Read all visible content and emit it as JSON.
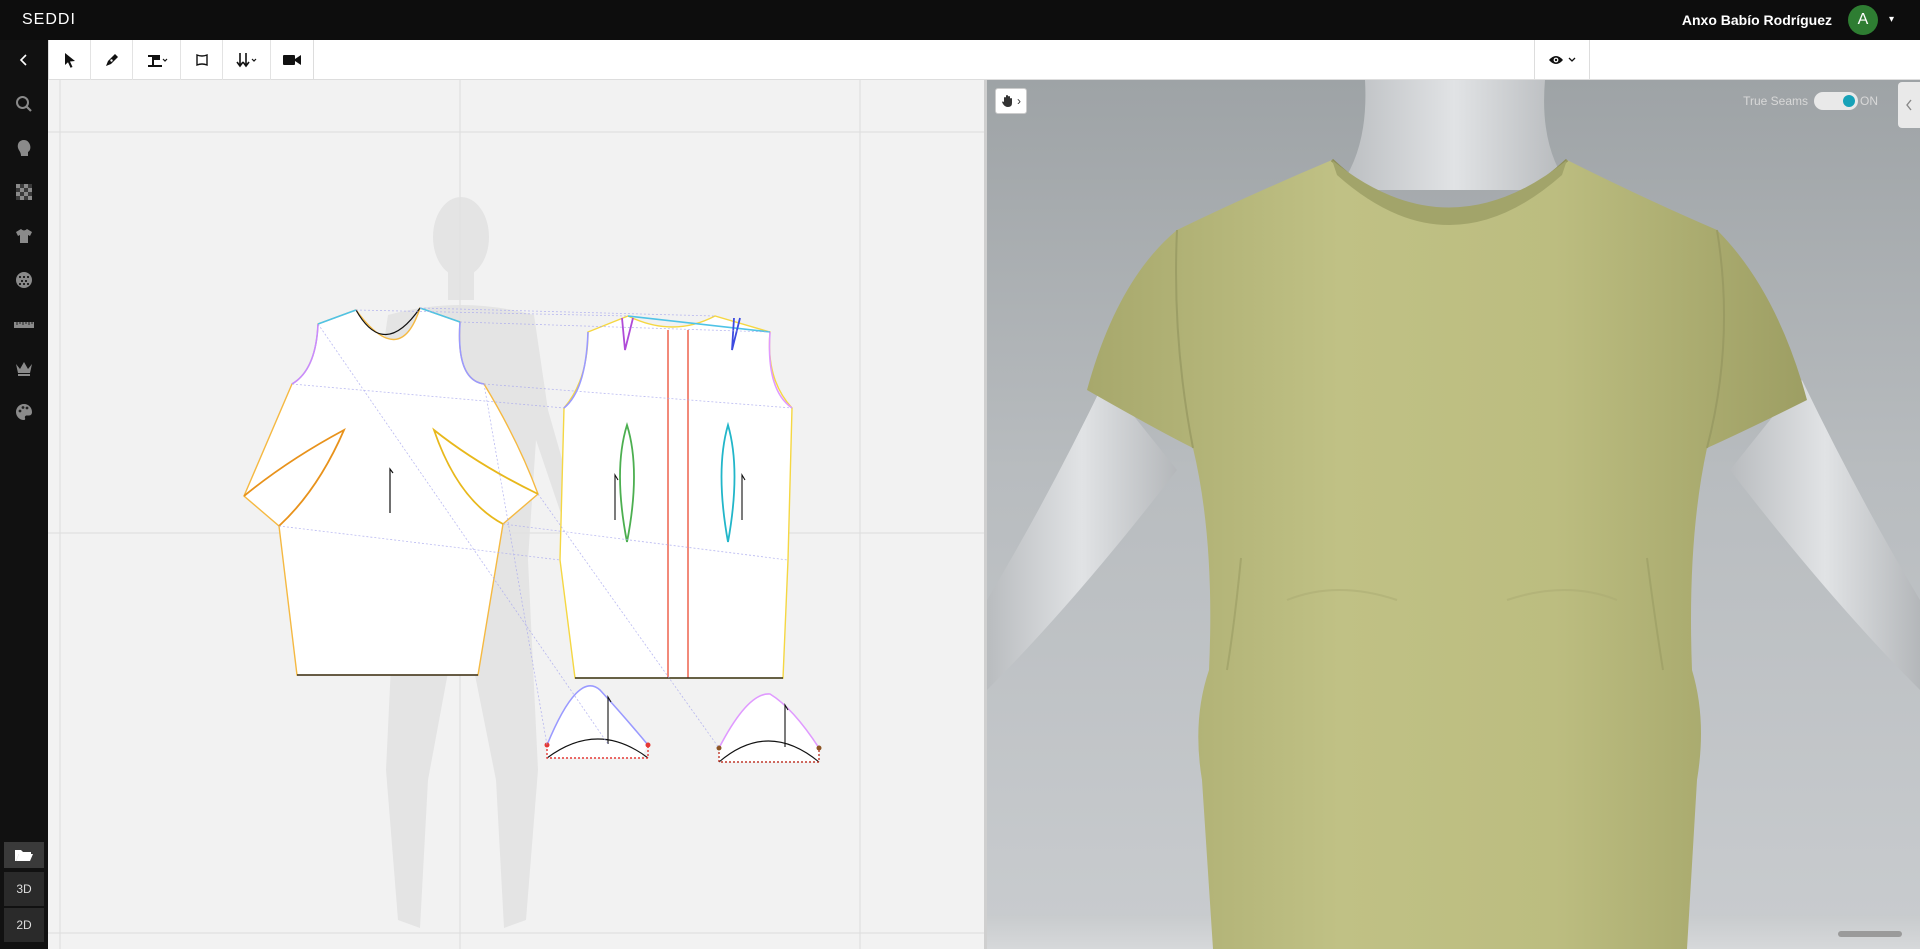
{
  "app": {
    "logo": "SEDDI",
    "user_name": "Anxo Babío Rodríguez",
    "avatar_initial": "A"
  },
  "toolbar": {
    "back_icon": "chevron-left-icon",
    "tools": [
      "select-arrow-icon",
      "pen-icon",
      "sewing-machine-icon",
      "pattern-piece-icon",
      "arrange-icon",
      "camera-icon"
    ],
    "view_icon": "eye-icon"
  },
  "sidebar": {
    "icons": [
      "search-icon",
      "avatar-head-icon",
      "fabric-pattern-icon",
      "garment-icon",
      "material-ball-icon",
      "ruler-icon",
      "crown-icon",
      "palette-icon"
    ],
    "folder_icon": "folder-open-icon",
    "mode_3d": "3D",
    "mode_2d": "2D"
  },
  "view3d": {
    "true_seams_label": "True Seams",
    "true_seams_state": "ON",
    "hand_icon": "hand-icon",
    "garment_color": "#b9ba7d",
    "mannequin_color": "#d3d6d8"
  },
  "colors": {
    "accent": "#17a2b8",
    "avatar_bg": "#2e7d32"
  }
}
